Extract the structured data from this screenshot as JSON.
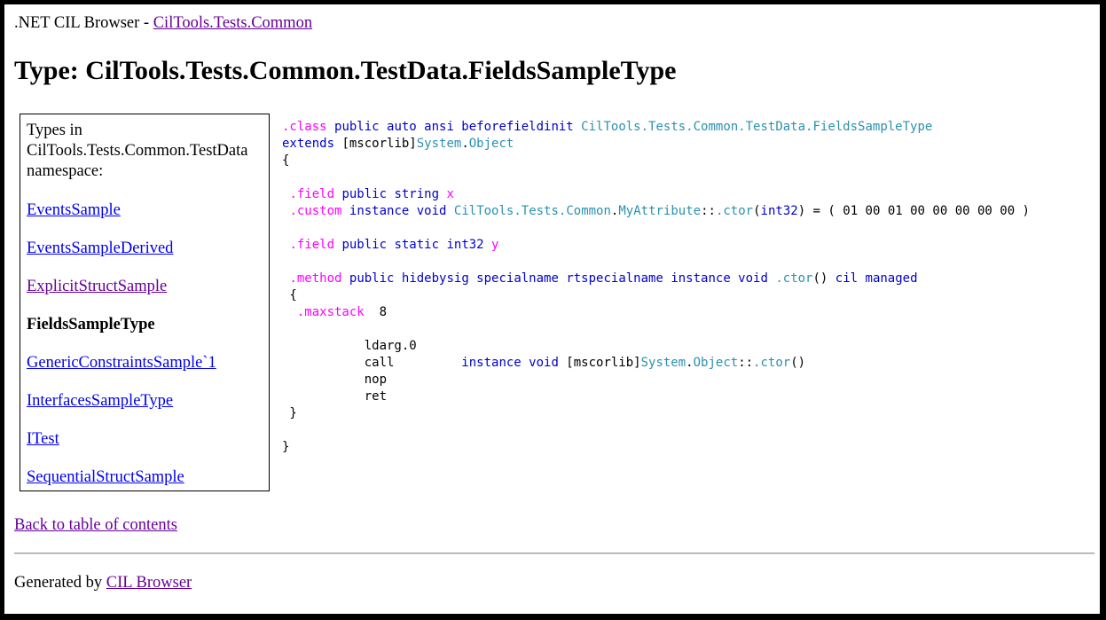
{
  "header": {
    "prefix": ".NET CIL Browser - ",
    "assembly_link": "CilTools.Tests.Common"
  },
  "title": "Type: CilTools.Tests.Common.TestData.FieldsSampleType",
  "sidebar": {
    "heading": "Types in CilTools.Tests.Common.TestData namespace:",
    "items": [
      {
        "label": "EventsSample",
        "state": "link"
      },
      {
        "label": "EventsSampleDerived",
        "state": "link"
      },
      {
        "label": "ExplicitStructSample",
        "state": "visited"
      },
      {
        "label": "FieldsSampleType",
        "state": "current"
      },
      {
        "label": "GenericConstraintsSample`1",
        "state": "link"
      },
      {
        "label": "InterfacesSampleType",
        "state": "link"
      },
      {
        "label": "ITest",
        "state": "link"
      },
      {
        "label": "SequentialStructSample",
        "state": "link"
      }
    ]
  },
  "code_lines": [
    [
      [
        ".class",
        "dir"
      ],
      [
        " "
      ],
      [
        "public auto ansi beforefieldinit",
        "kw"
      ],
      [
        " "
      ],
      [
        "CilTools.Tests.Common.TestData.FieldsSampleType",
        "nm"
      ]
    ],
    [
      [
        "extends",
        "kw"
      ],
      [
        " [mscorlib]"
      ],
      [
        "System",
        "nm"
      ],
      [
        "."
      ],
      [
        "Object",
        "nm"
      ]
    ],
    [
      [
        "{"
      ]
    ],
    [
      [
        ""
      ]
    ],
    [
      [
        " "
      ],
      [
        ".field",
        "dir"
      ],
      [
        " "
      ],
      [
        "public string",
        "kw"
      ],
      [
        " "
      ],
      [
        "x",
        "dir"
      ]
    ],
    [
      [
        " "
      ],
      [
        ".custom",
        "dir"
      ],
      [
        " "
      ],
      [
        "instance void",
        "kw"
      ],
      [
        " "
      ],
      [
        "CilTools.Tests.Common",
        "nm"
      ],
      [
        "."
      ],
      [
        "MyAttribute",
        "nm"
      ],
      [
        "::"
      ],
      [
        ".ctor",
        "nm"
      ],
      [
        "("
      ],
      [
        "int32",
        "kw"
      ],
      [
        ") = ( 01 00 01 00 00 00 00 00 )"
      ]
    ],
    [
      [
        ""
      ]
    ],
    [
      [
        " "
      ],
      [
        ".field",
        "dir"
      ],
      [
        " "
      ],
      [
        "public static int32",
        "kw"
      ],
      [
        " "
      ],
      [
        "y",
        "dir"
      ]
    ],
    [
      [
        ""
      ]
    ],
    [
      [
        " "
      ],
      [
        ".method",
        "dir"
      ],
      [
        " "
      ],
      [
        "public hidebysig specialname rtspecialname instance void",
        "kw"
      ],
      [
        " "
      ],
      [
        ".ctor",
        "nm"
      ],
      [
        "() "
      ],
      [
        "cil managed",
        "kw"
      ]
    ],
    [
      [
        " {"
      ]
    ],
    [
      [
        "  "
      ],
      [
        ".maxstack",
        "dir"
      ],
      [
        "  8"
      ]
    ],
    [
      [
        ""
      ]
    ],
    [
      [
        "           ldarg.0"
      ]
    ],
    [
      [
        "           call         "
      ],
      [
        "instance void",
        "kw"
      ],
      [
        " [mscorlib]"
      ],
      [
        "System",
        "nm"
      ],
      [
        "."
      ],
      [
        "Object",
        "nm"
      ],
      [
        "::"
      ],
      [
        ".ctor",
        "nm"
      ],
      [
        "()"
      ]
    ],
    [
      [
        "           nop"
      ]
    ],
    [
      [
        "           ret"
      ]
    ],
    [
      [
        " }"
      ]
    ],
    [
      [
        ""
      ]
    ],
    [
      [
        "}"
      ]
    ]
  ],
  "back_link": "Back to table of contents",
  "footer": {
    "prefix": "Generated by ",
    "link": "CIL Browser"
  },
  "colors": {
    "link": "#0000EE",
    "visited": "#660099",
    "keyword": "#0000CC",
    "directive": "#FF00FF",
    "name": "#2B91AF"
  }
}
